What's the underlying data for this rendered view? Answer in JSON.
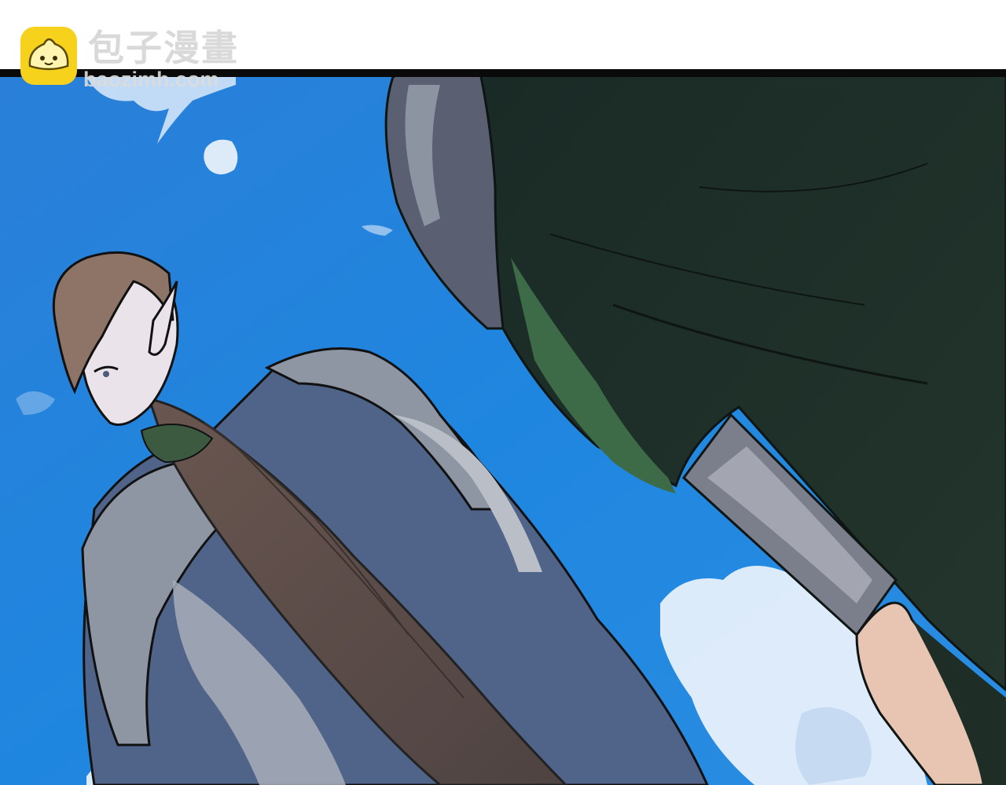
{
  "watermark": {
    "title": "包子漫畫",
    "url": "baozimh.com",
    "icon": "steamed-bun-icon",
    "icon_color": "#f7d21c"
  },
  "scene": {
    "sky_color": "#1f7fd6",
    "cloud_color": "#e9f2fb",
    "elf_hair_color": "#5e4e4b",
    "elf_cloak_color": "#4f6488",
    "green_robe_color": "#1f3a2c"
  }
}
